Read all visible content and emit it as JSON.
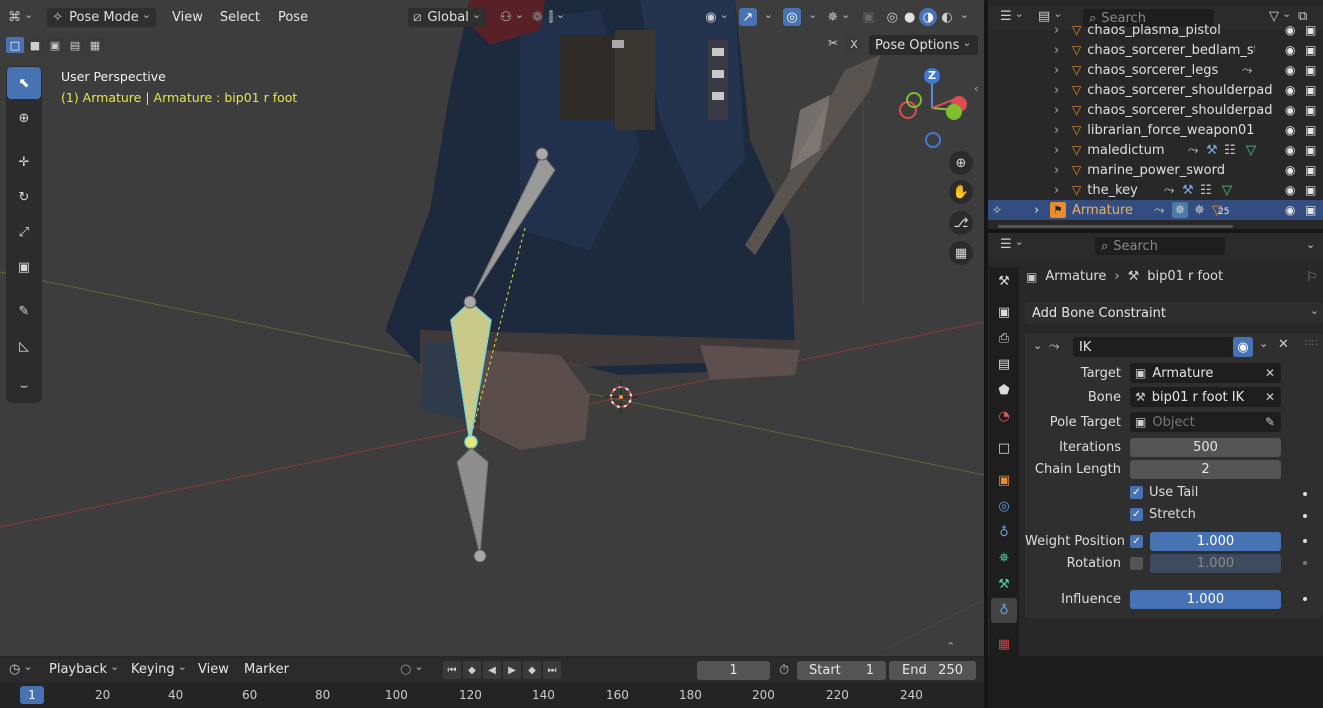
{
  "viewport_header": {
    "editor_icon": "cube-editor-icon",
    "mode": "Pose Mode",
    "menus": [
      "View",
      "Select",
      "Pose"
    ],
    "orientation": "Global",
    "pose_options": "Pose Options"
  },
  "viewport": {
    "view_name": "User Perspective",
    "context": "(1) Armature | Armature : bip01 r foot",
    "gizmo_axis_label": "Z"
  },
  "outliner": {
    "search_placeholder": "Search",
    "items": [
      {
        "label": "chaos_plasma_pistol"
      },
      {
        "label": "chaos_sorcerer_bedlam_staff"
      },
      {
        "label": "chaos_sorcerer_legs"
      },
      {
        "label": "chaos_sorcerer_shoulderpad"
      },
      {
        "label": "chaos_sorcerer_shoulderpad"
      },
      {
        "label": "librarian_force_weapon01"
      },
      {
        "label": "maledictum"
      },
      {
        "label": "marine_power_sword"
      },
      {
        "label": "the_key"
      }
    ],
    "selected": {
      "label": "Armature",
      "badge": "25"
    }
  },
  "properties": {
    "search_placeholder": "Search",
    "breadcrumb": {
      "object": "Armature",
      "bone": "bip01 r foot"
    },
    "add_constraint": "Add Bone Constraint",
    "constraint": {
      "name": "IK",
      "target_label": "Target",
      "target_value": "Armature",
      "bone_label": "Bone",
      "bone_value": "bip01 r foot IK",
      "pole_label": "Pole Target",
      "pole_placeholder": "Object",
      "iterations_label": "Iterations",
      "iterations_value": "500",
      "chain_label": "Chain Length",
      "chain_value": "2",
      "use_tail_label": "Use Tail",
      "stretch_label": "Stretch",
      "weight_position_label": "Weight Position",
      "weight_position_value": "1.000",
      "rotation_label": "Rotation",
      "rotation_value": "1.000",
      "influence_label": "Influence",
      "influence_value": "1.000"
    }
  },
  "timeline": {
    "menus": [
      "Playback",
      "Keying",
      "View",
      "Marker"
    ],
    "current_frame": "1",
    "start_label": "Start",
    "start_value": "1",
    "end_label": "End",
    "end_value": "250",
    "ruler": [
      "1",
      "20",
      "40",
      "60",
      "80",
      "100",
      "120",
      "140",
      "160",
      "180",
      "200",
      "220",
      "240"
    ]
  },
  "colors": {
    "accent": "#4772b3",
    "bone_selected": "#d9d9a0",
    "context_text": "#e6e64a"
  }
}
